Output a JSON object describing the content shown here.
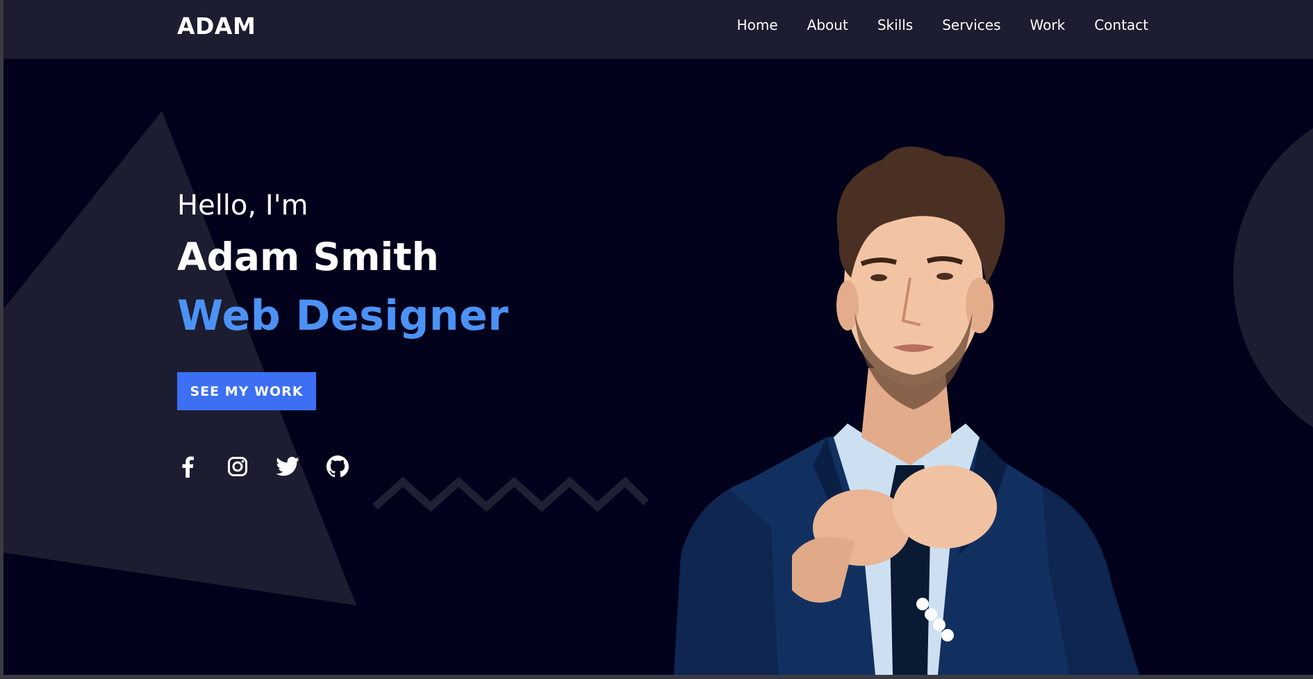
{
  "brand": {
    "logo": "ADAM"
  },
  "nav": {
    "items": [
      {
        "label": "Home"
      },
      {
        "label": "About"
      },
      {
        "label": "Skills"
      },
      {
        "label": "Services"
      },
      {
        "label": "Work"
      },
      {
        "label": "Contact"
      }
    ]
  },
  "hero": {
    "greeting": "Hello, I'm",
    "name": "Adam Smith",
    "role": "Web Designer",
    "cta_label": "SEE MY WORK",
    "social": [
      {
        "icon": "facebook-icon"
      },
      {
        "icon": "instagram-icon"
      },
      {
        "icon": "twitter-icon"
      },
      {
        "icon": "github-icon"
      }
    ],
    "portrait_icon": "man-in-suit-portrait"
  },
  "colors": {
    "background": "#01011c",
    "navbar": "#1c1d30",
    "accent_text": "#4c92f6",
    "button": "#3c6ff3",
    "shape": "#1c1d30"
  }
}
